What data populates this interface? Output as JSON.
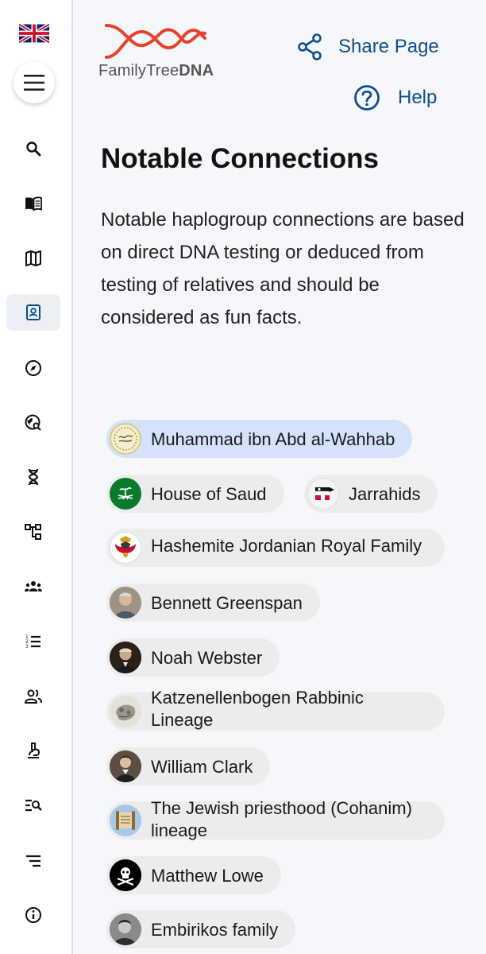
{
  "header": {
    "logo_text_light": "FamilyTree",
    "logo_text_bold": "DNA",
    "share_label": "Share Page",
    "help_label": "Help"
  },
  "sidebar": {
    "items": [
      {
        "icon": "search-icon"
      },
      {
        "icon": "book-icon"
      },
      {
        "icon": "map-icon"
      },
      {
        "icon": "contact-card-icon",
        "active": true
      },
      {
        "icon": "compass-icon"
      },
      {
        "icon": "globe-search-icon"
      },
      {
        "icon": "dna-icon"
      },
      {
        "icon": "tree-diagram-icon"
      },
      {
        "icon": "groups-icon"
      },
      {
        "icon": "numbered-list-icon"
      },
      {
        "icon": "people-icon"
      },
      {
        "icon": "microscope-icon"
      },
      {
        "icon": "list-search-icon"
      },
      {
        "icon": "sort-lines-icon"
      },
      {
        "icon": "info-icon"
      }
    ]
  },
  "main": {
    "title": "Notable Connections",
    "intro": "Notable haplogroup connections are based on direct DNA testing or deduced from testing of relatives and should be considered as fun facts.",
    "connections": [
      {
        "label": "Muhammad ibn Abd al-Wahhab",
        "selected": true
      },
      {
        "label": "House of Saud"
      },
      {
        "label": "Jarrahids"
      },
      {
        "label": "Hashemite Jordanian Royal Family"
      },
      {
        "label": "Bennett Greenspan"
      },
      {
        "label": "Noah Webster"
      },
      {
        "label": "Katzenellenbogen Rabbinic Lineage"
      },
      {
        "label": "William Clark"
      },
      {
        "label": "The Jewish priesthood (Cohanim) lineage"
      },
      {
        "label": "Matthew Lowe"
      },
      {
        "label": "Embirikos family"
      }
    ]
  },
  "colors": {
    "accent": "#0d4f8f",
    "logo_red": "#e8412c",
    "chip_bg": "#ececec",
    "chip_selected_bg": "#d4e3fb"
  }
}
